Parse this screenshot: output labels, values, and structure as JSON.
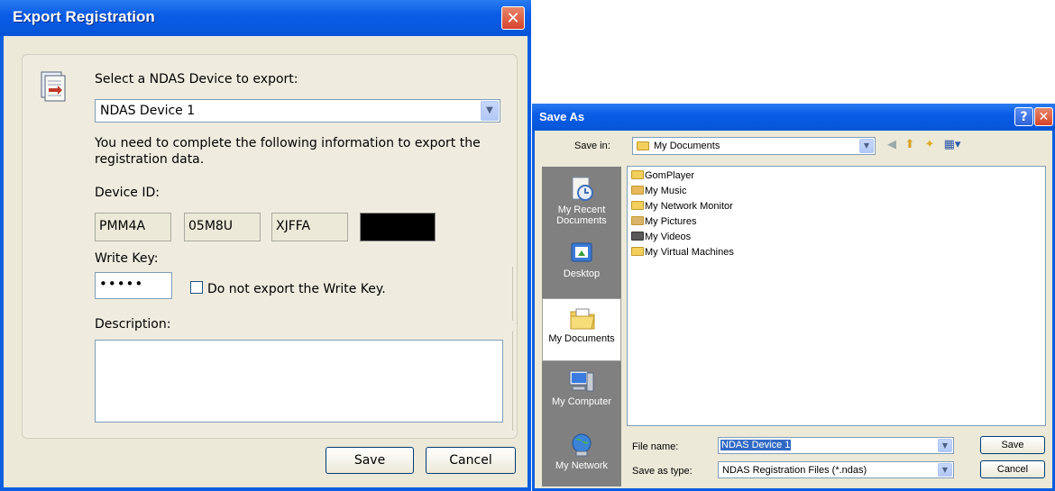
{
  "export_dialog": {
    "title": "Export Registration",
    "select_label": "Select a NDAS Device to export:",
    "device_selected": "NDAS Device 1",
    "info_text_line1": "You need to complete the following information to export the",
    "info_text_line2": "registration data.",
    "device_id_label": "Device ID:",
    "device_id_parts": [
      "PMM4A",
      "05M8U",
      "XJFFA"
    ],
    "write_key_label": "Write Key:",
    "write_key_value": "•••••",
    "no_export_checkbox_label": "Do not export the Write Key.",
    "description_label": "Description:",
    "description_value": "",
    "save_button": "Save",
    "cancel_button": "Cancel",
    "close_symbol": "✕"
  },
  "save_as_dialog": {
    "title": "Save As",
    "help_symbol": "?",
    "close_symbol": "✕",
    "save_in_label": "Save in:",
    "save_in_value": "My Documents",
    "places": [
      {
        "label_line1": "My Recent",
        "label_line2": "Documents",
        "icon": "recent-documents-icon"
      },
      {
        "label_line1": "Desktop",
        "label_line2": "",
        "icon": "desktop-icon"
      },
      {
        "label_line1": "My Documents",
        "label_line2": "",
        "icon": "my-documents-icon"
      },
      {
        "label_line1": "My Computer",
        "label_line2": "",
        "icon": "my-computer-icon"
      },
      {
        "label_line1": "My Network",
        "label_line2": "",
        "icon": "my-network-icon"
      }
    ],
    "files": [
      "GomPlayer",
      "My Music",
      "My Network Monitor",
      "My Pictures",
      "My Videos",
      "My Virtual Machines"
    ],
    "file_name_label": "File name:",
    "file_name_value": "NDAS Device 1",
    "save_as_type_label": "Save as type:",
    "save_as_type_value": "NDAS Registration Files (*.ndas)",
    "save_button": "Save",
    "cancel_button": "Cancel"
  }
}
